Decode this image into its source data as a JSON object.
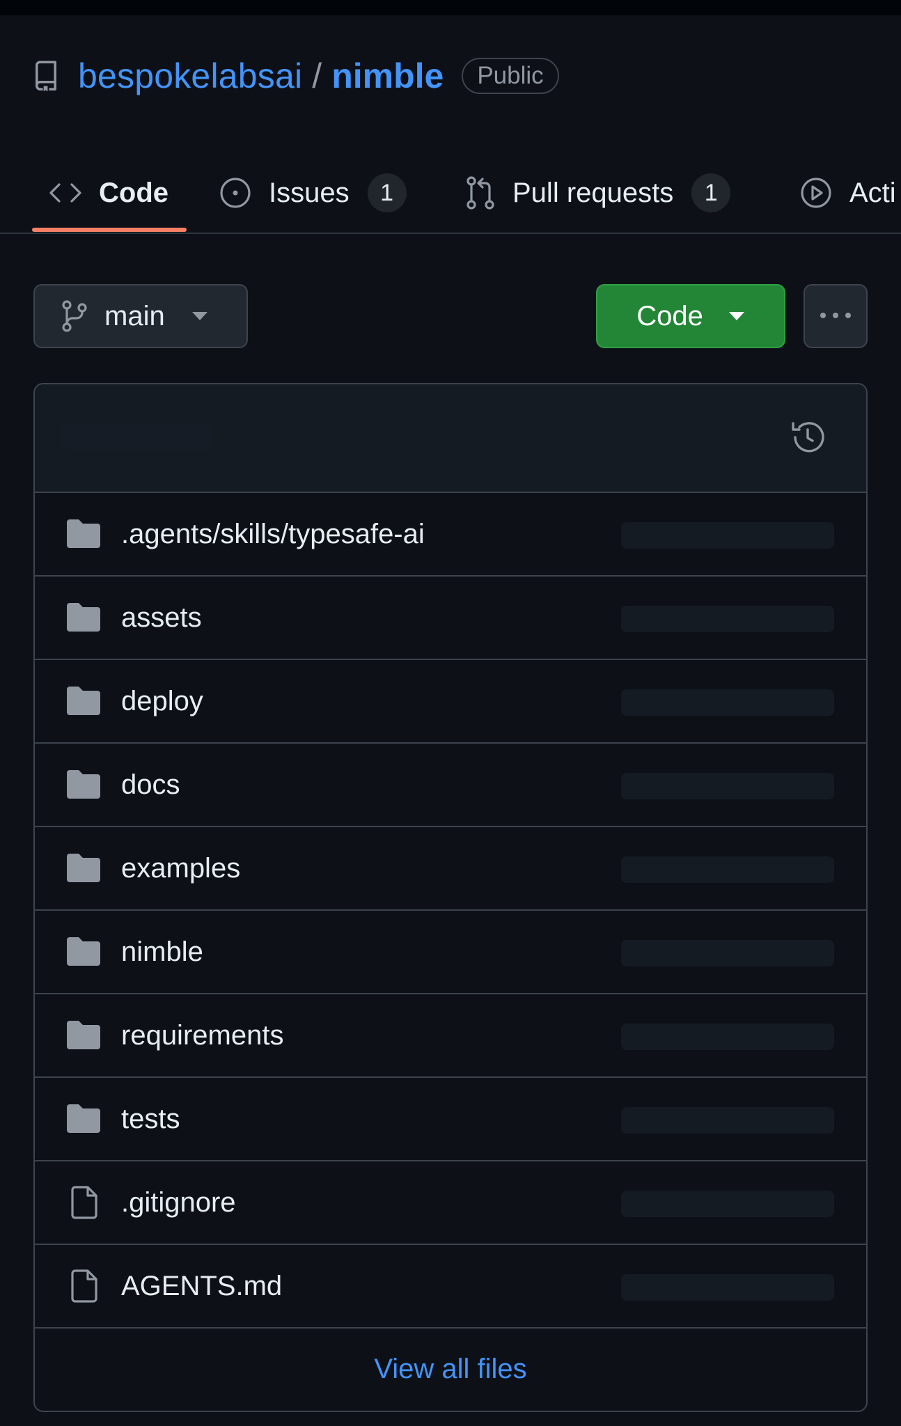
{
  "colors": {
    "background": "#0d1117",
    "link": "#4493f8",
    "primary_button": "#238636",
    "tab_underline": "#f78166",
    "muted": "#9198a1"
  },
  "repo": {
    "owner": "bespokelabsai",
    "separator": "/",
    "name": "nimble",
    "visibility": "Public",
    "icon": "repo-icon"
  },
  "tabs": [
    {
      "label": "Code",
      "icon": "code-icon",
      "selected": true
    },
    {
      "label": "Issues",
      "icon": "issue-opened-icon",
      "count": "1"
    },
    {
      "label": "Pull requests",
      "icon": "git-pull-request-icon",
      "count": "1"
    },
    {
      "label": "Acti",
      "icon": "play-icon"
    }
  ],
  "toolbar": {
    "branch": "main",
    "branch_icon": "git-branch-icon",
    "code_button": "Code",
    "more_icon": "kebab-horizontal-icon"
  },
  "files": [
    {
      "name": ".agents/skills/typesafe-ai",
      "type": "folder"
    },
    {
      "name": "assets",
      "type": "folder"
    },
    {
      "name": "deploy",
      "type": "folder"
    },
    {
      "name": "docs",
      "type": "folder"
    },
    {
      "name": "examples",
      "type": "folder"
    },
    {
      "name": "nimble",
      "type": "folder"
    },
    {
      "name": "requirements",
      "type": "folder"
    },
    {
      "name": "tests",
      "type": "folder"
    },
    {
      "name": ".gitignore",
      "type": "file"
    },
    {
      "name": "AGENTS.md",
      "type": "file"
    }
  ],
  "view_all": "View all files"
}
